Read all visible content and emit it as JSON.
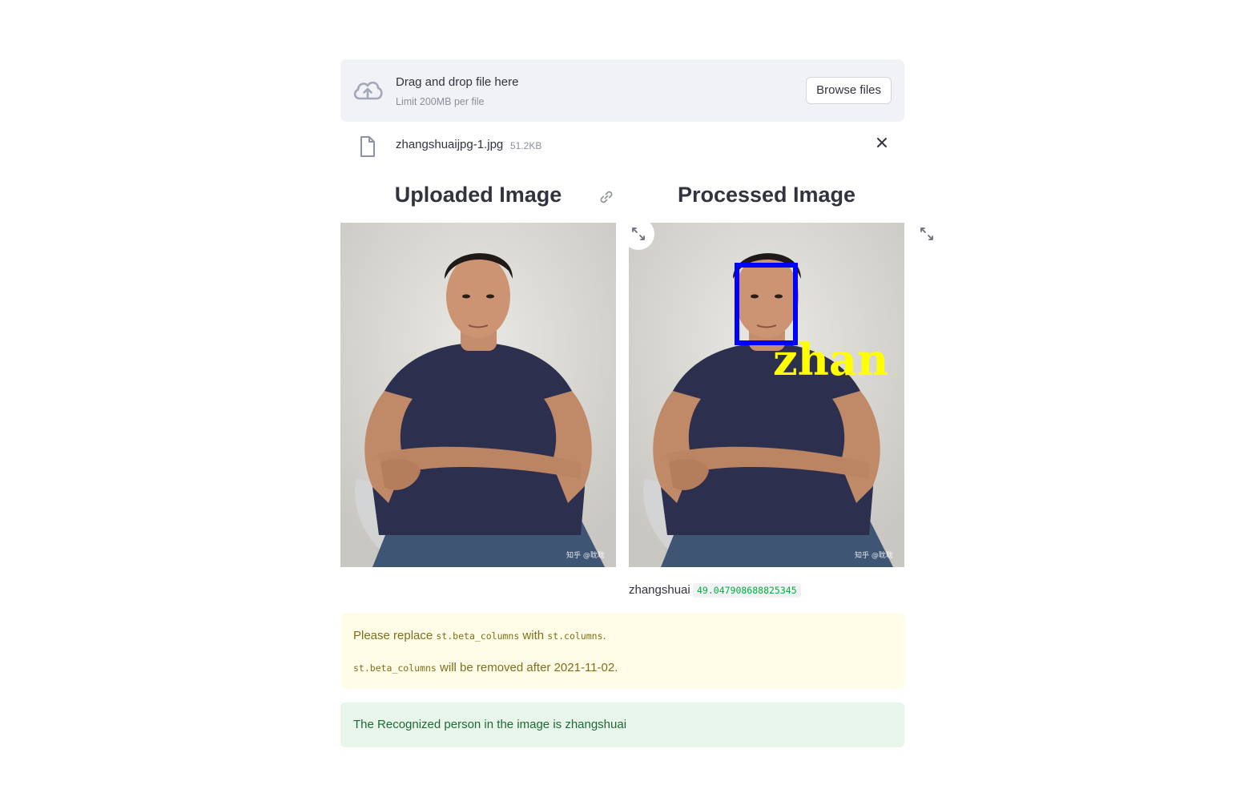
{
  "uploader": {
    "drag_text": "Drag and drop file here",
    "limit_text": "Limit 200MB per file",
    "browse_label": "Browse files"
  },
  "file": {
    "name": "zhangshuaijpg-1.jpg",
    "size": "51.2KB"
  },
  "columns": {
    "left_title": "Uploaded Image",
    "right_title": "Processed Image"
  },
  "processed": {
    "overlay_text": "zhan",
    "box_color": "#0000ff",
    "text_color": "#ffff00"
  },
  "photo_watermark": "知乎 @耽耽",
  "result_caption": {
    "name": "zhangshuai",
    "score": "49.047908688825345"
  },
  "warning": {
    "line1_pre": "Please replace ",
    "line1_code1": "st.beta_columns",
    "line1_mid": " with ",
    "line1_code2": "st.columns",
    "line1_post": ".",
    "line2_code": "st.beta_columns",
    "line2_post": " will be removed after 2021-11-02."
  },
  "success_message": "The Recognized person in the image is zhangshuai",
  "colors": {
    "uploader_bg": "#f0f2f6",
    "warning_bg": "#fffce7",
    "success_bg": "#e8f5ea"
  }
}
